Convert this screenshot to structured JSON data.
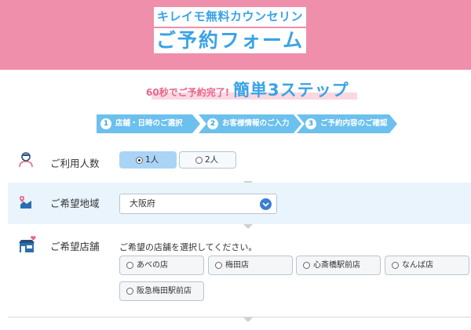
{
  "header": {
    "subtitle": "キレイモ無料カウンセリング",
    "title": "ご予約フォーム",
    "background_color": "#ef8fab",
    "accent_color": "#3aa3e6"
  },
  "steps": {
    "lead": "60秒でご予約完了!",
    "main": "簡単3ステップ",
    "items": [
      {
        "number": "1",
        "label": "店舗・日時のご選択"
      },
      {
        "number": "2",
        "label": "お客様情報のご入力"
      },
      {
        "number": "3",
        "label": "ご予約内容のご確認"
      }
    ]
  },
  "people": {
    "label": "ご利用人数",
    "icon": "person-icon",
    "options": [
      {
        "label": "1人",
        "selected": true
      },
      {
        "label": "2人",
        "selected": false
      }
    ]
  },
  "area": {
    "label": "ご希望地域",
    "icon": "map-pin-icon",
    "selected_value": "大阪府"
  },
  "shop": {
    "label": "ご希望店舗",
    "icon": "shop-icon",
    "hint": "ご希望の店舗を選択してください。",
    "options": [
      {
        "label": "あべの店"
      },
      {
        "label": "梅田店"
      },
      {
        "label": "心斎橋駅前店"
      },
      {
        "label": "なんば店"
      },
      {
        "label": "阪急梅田駅前店"
      }
    ]
  }
}
